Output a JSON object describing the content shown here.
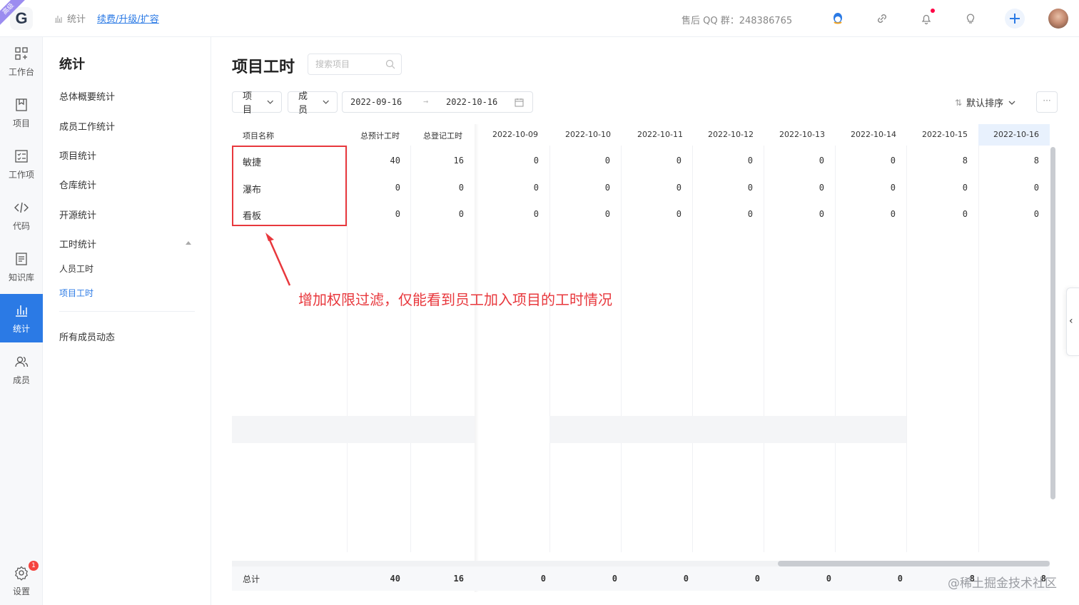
{
  "topbar": {
    "logo_letter": "G",
    "ribbon": "高级",
    "breadcrumb_label": "统计",
    "upgrade_link": "续费/升级/扩容",
    "support_text": "售后 QQ 群：248386765"
  },
  "leftnav": [
    {
      "label": "工作台",
      "icon": "dashboard-icon"
    },
    {
      "label": "项目",
      "icon": "project-icon"
    },
    {
      "label": "工作项",
      "icon": "workitem-icon"
    },
    {
      "label": "代码",
      "icon": "code-icon"
    },
    {
      "label": "知识库",
      "icon": "wiki-icon"
    },
    {
      "label": "统计",
      "icon": "chart-icon"
    },
    {
      "label": "成员",
      "icon": "members-icon"
    }
  ],
  "settings": {
    "label": "设置",
    "badge": "1"
  },
  "subnav": {
    "title": "统计",
    "items": [
      "总体概要统计",
      "成员工作统计",
      "项目统计",
      "仓库统计",
      "开源统计",
      "工时统计"
    ],
    "subitems": [
      "人员工时",
      "项目工时"
    ],
    "bottom_item": "所有成员动态"
  },
  "main": {
    "title": "项目工时",
    "search_placeholder": "搜索项目",
    "filter_project": "项目",
    "filter_member": "成员",
    "date_start": "2022-09-16",
    "date_arrow": "→",
    "date_end": "2022-10-16",
    "sort_label": "默认排序",
    "more": "···"
  },
  "table": {
    "headers": [
      "项目名称",
      "总预计工时",
      "总登记工时"
    ],
    "dates": [
      "2022-10-09",
      "2022-10-10",
      "2022-10-11",
      "2022-10-12",
      "2022-10-13",
      "2022-10-14",
      "2022-10-15",
      "2022-10-16"
    ],
    "rows": [
      {
        "name": "敏捷",
        "est": "40",
        "logged": "16",
        "days": [
          "0",
          "0",
          "0",
          "0",
          "0",
          "0",
          "8",
          "8"
        ]
      },
      {
        "name": "瀑布",
        "est": "0",
        "logged": "0",
        "days": [
          "0",
          "0",
          "0",
          "0",
          "0",
          "0",
          "0",
          "0"
        ]
      },
      {
        "name": "看板",
        "est": "0",
        "logged": "0",
        "days": [
          "0",
          "0",
          "0",
          "0",
          "0",
          "0",
          "0",
          "0"
        ]
      }
    ],
    "total": {
      "label": "总计",
      "est": "40",
      "logged": "16",
      "days": [
        "0",
        "0",
        "0",
        "0",
        "0",
        "0",
        "8",
        "8"
      ]
    }
  },
  "annotation": "增加权限过滤，仅能看到员工加入项目的工时情况",
  "side_tab": "‹",
  "watermark": "@稀土掘金技术社区",
  "colors": {
    "accent": "#2b7ae5",
    "annotation": "#e8383d",
    "badge": "#f5433e"
  }
}
